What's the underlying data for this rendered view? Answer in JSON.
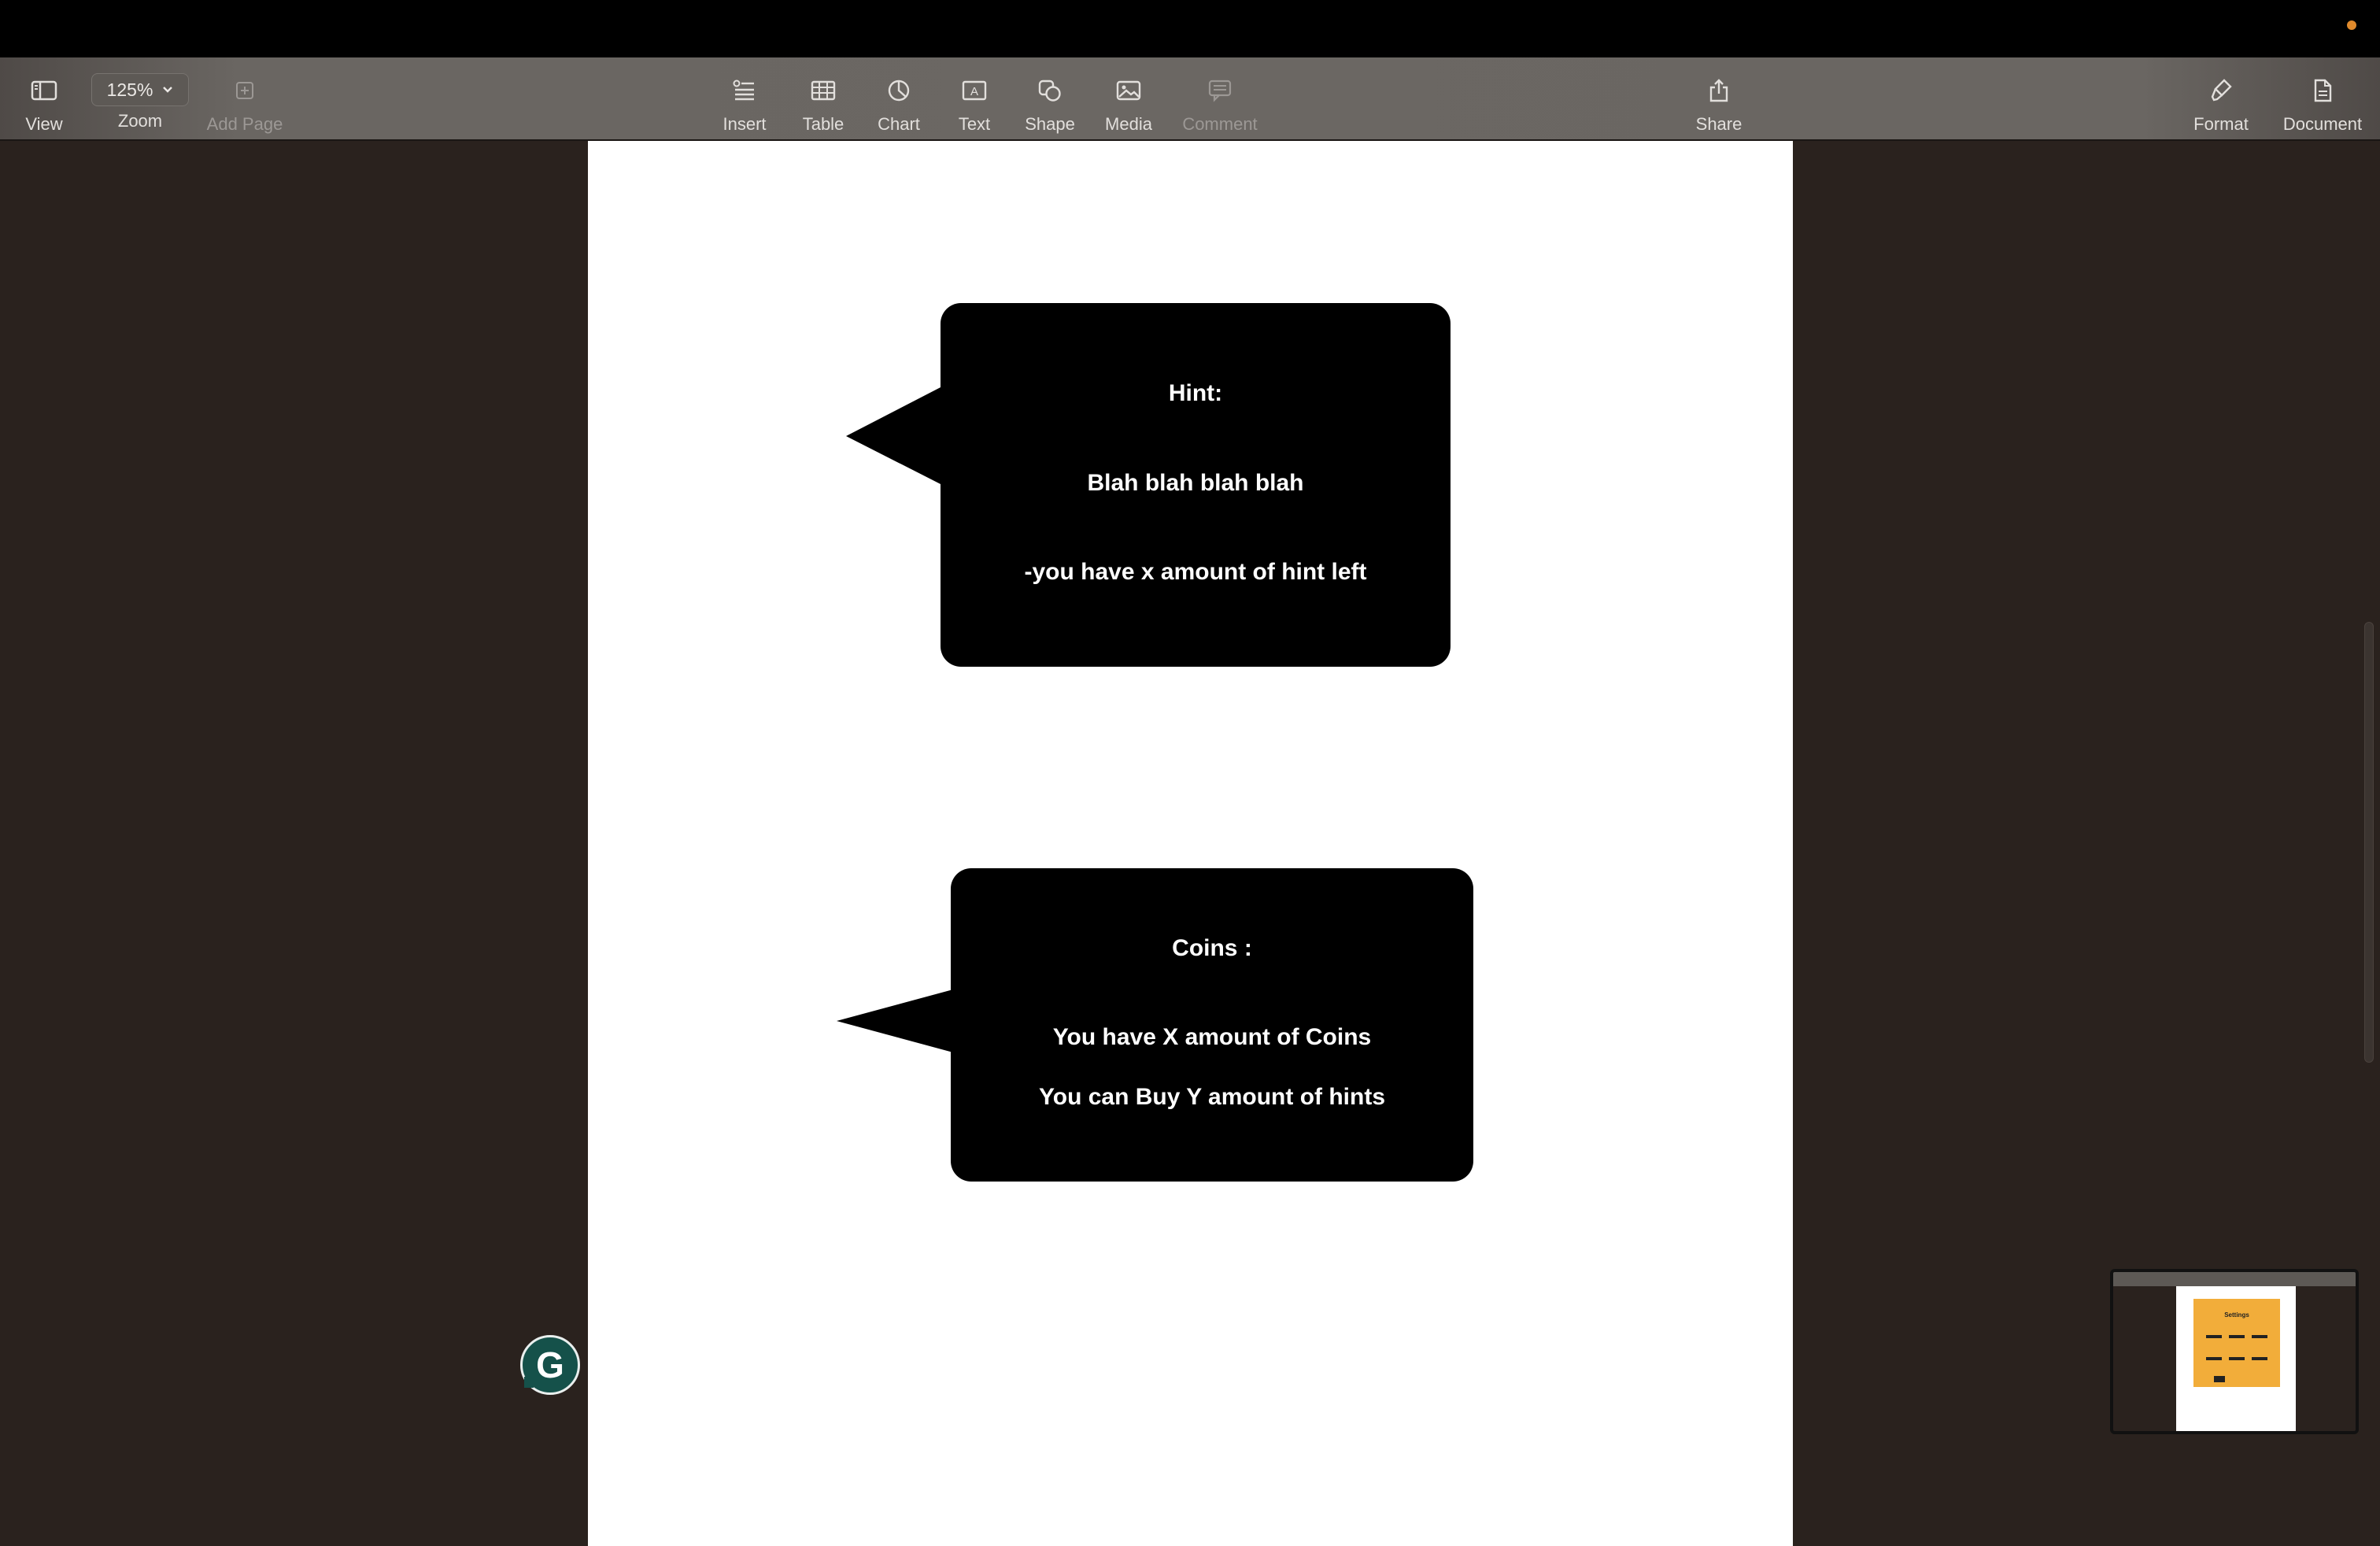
{
  "toolbar": {
    "view_label": "View",
    "zoom_value": "125%",
    "zoom_label": "Zoom",
    "add_page_label": "Add Page",
    "insert_label": "Insert",
    "table_label": "Table",
    "chart_label": "Chart",
    "text_label": "Text",
    "shape_label": "Shape",
    "media_label": "Media",
    "comment_label": "Comment",
    "share_label": "Share",
    "format_label": "Format",
    "document_label": "Document"
  },
  "document": {
    "hint_bubble": {
      "title": "Hint:",
      "body": "Blah blah blah blah",
      "footer": "-you have x amount of hint left"
    },
    "coins_bubble": {
      "title": "Coins :",
      "line1": "You have X amount of Coins",
      "line2": "You can Buy Y amount of hints"
    }
  },
  "thumbnail": {
    "title": "Settings"
  },
  "colors": {
    "background": "#2a221e",
    "toolbar": "#6b6763",
    "bubble": "#000000",
    "accent_dot": "#e08a2c",
    "grammarly": "#15514a",
    "thumbnail_card": "#f2ad3a"
  }
}
